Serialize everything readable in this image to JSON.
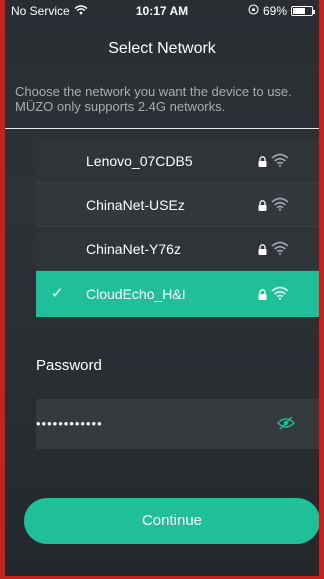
{
  "status_bar": {
    "carrier": "No Service",
    "time": "10:17 AM",
    "battery_percent": "69%",
    "battery_level": 0.69
  },
  "header": {
    "title": "Select Network"
  },
  "description": "Choose the network you want the device to use. MÜZO only supports 2.4G networks.",
  "networks": [
    {
      "name": "Lenovo_07CDB5",
      "secured": true,
      "selected": false
    },
    {
      "name": "ChinaNet-USEz",
      "secured": true,
      "selected": false
    },
    {
      "name": "ChinaNet-Y76z",
      "secured": true,
      "selected": false
    },
    {
      "name": "CloudEcho_H&I",
      "secured": true,
      "selected": true
    }
  ],
  "password": {
    "label": "Password",
    "masked_value": "••••••••••••"
  },
  "actions": {
    "continue_label": "Continue"
  },
  "colors": {
    "accent": "#1fbf9a",
    "background": "#2d3237",
    "frame_border": "#c8201e"
  },
  "icons": {
    "wifi": "wifi-icon",
    "lock": "lock-icon",
    "check": "checkmark-icon",
    "eye": "eye-slash-icon"
  }
}
